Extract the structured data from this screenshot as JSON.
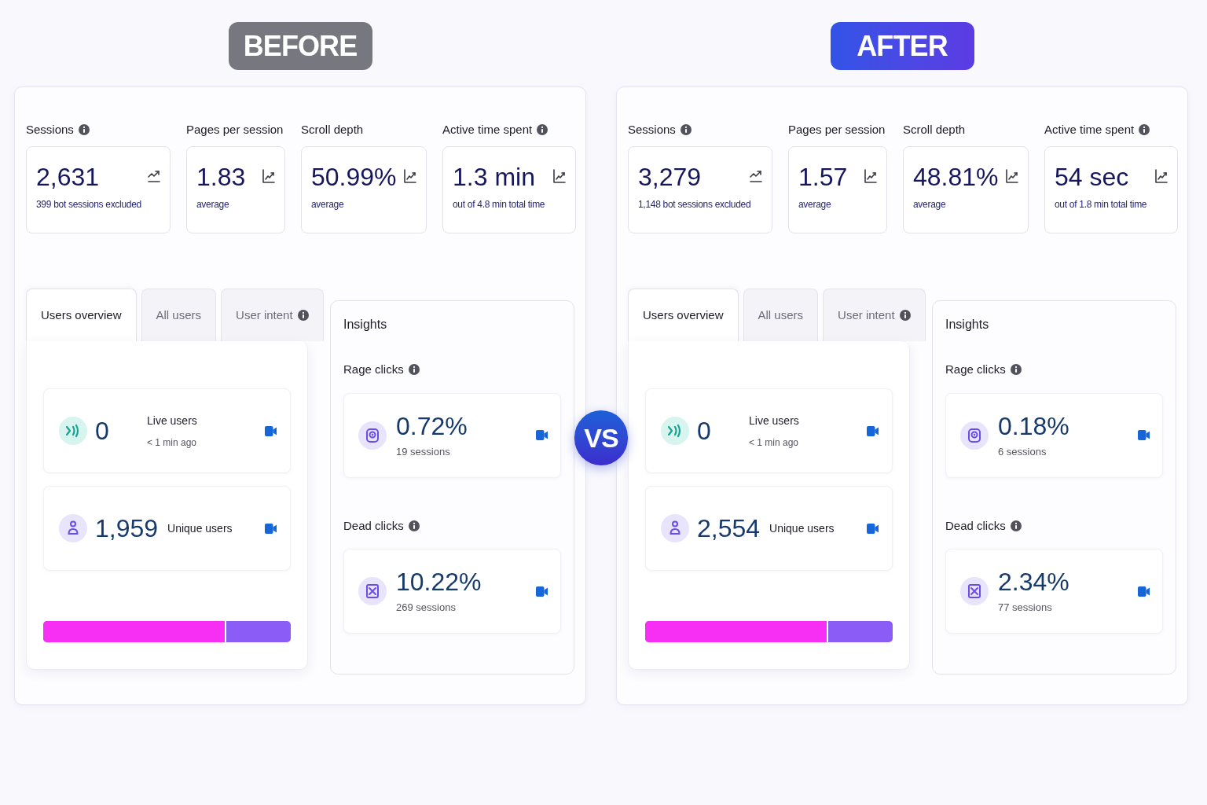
{
  "panels": [
    {
      "badge": {
        "label": "BEFORE",
        "kind": "before"
      },
      "metrics": [
        {
          "label": "Sessions",
          "info": true,
          "value": "2,631",
          "note": "399 bot sessions excluded",
          "kind": "trend"
        },
        {
          "label": "Pages per session",
          "info": false,
          "value": "1.83",
          "note": "average",
          "kind": "chart"
        },
        {
          "label": "Scroll depth",
          "info": false,
          "value": "50.99%",
          "note": "average",
          "kind": "chart"
        },
        {
          "label": "Active time spent",
          "info": true,
          "value": "1.3 min",
          "note": "out of 4.8 min total time",
          "kind": "chart"
        }
      ],
      "tabs": [
        {
          "label": "Users overview",
          "selected": true,
          "info": false
        },
        {
          "label": "All users",
          "selected": false,
          "info": false
        },
        {
          "label": "User intent",
          "selected": false,
          "info": true
        }
      ],
      "users": [
        {
          "kind": "live",
          "value": "0",
          "label": "Live users",
          "sublabel": "< 1 min ago"
        },
        {
          "kind": "unique",
          "value": "1,959",
          "label": "Unique users"
        }
      ],
      "split_bar": {
        "level": 0.74
      },
      "insights": {
        "title": "Insights",
        "sections": [
          {
            "kind": "rage",
            "label": "Rage clicks",
            "info": true,
            "value": "0.72%",
            "sessions": "19 sessions"
          },
          {
            "kind": "dead",
            "label": "Dead clicks",
            "info": true,
            "value": "10.22%",
            "sessions": "269 sessions"
          }
        ]
      }
    },
    {
      "badge": {
        "label": "AFTER",
        "kind": "after"
      },
      "metrics": [
        {
          "label": "Sessions",
          "info": true,
          "value": "3,279",
          "note": "1,148 bot sessions excluded",
          "kind": "trend"
        },
        {
          "label": "Pages per session",
          "info": false,
          "value": "1.57",
          "note": "average",
          "kind": "chart"
        },
        {
          "label": "Scroll depth",
          "info": false,
          "value": "48.81%",
          "note": "average",
          "kind": "chart"
        },
        {
          "label": "Active time spent",
          "info": true,
          "value": "54 sec",
          "note": "out of 1.8 min total time",
          "kind": "chart"
        }
      ],
      "tabs": [
        {
          "label": "Users overview",
          "selected": true,
          "info": false
        },
        {
          "label": "All users",
          "selected": false,
          "info": false
        },
        {
          "label": "User intent",
          "selected": false,
          "info": true
        }
      ],
      "users": [
        {
          "kind": "live",
          "value": "0",
          "label": "Live users",
          "sublabel": "< 1 min ago"
        },
        {
          "kind": "unique",
          "value": "2,554",
          "label": "Unique users"
        }
      ],
      "split_bar": {
        "level": 0.74
      },
      "insights": {
        "title": "Insights",
        "sections": [
          {
            "kind": "rage",
            "label": "Rage clicks",
            "info": true,
            "value": "0.18%",
            "sessions": "6 sessions"
          },
          {
            "kind": "dead",
            "label": "Dead clicks",
            "info": true,
            "value": "2.34%",
            "sessions": "77 sessions"
          }
        ]
      }
    }
  ],
  "vs": "VS"
}
